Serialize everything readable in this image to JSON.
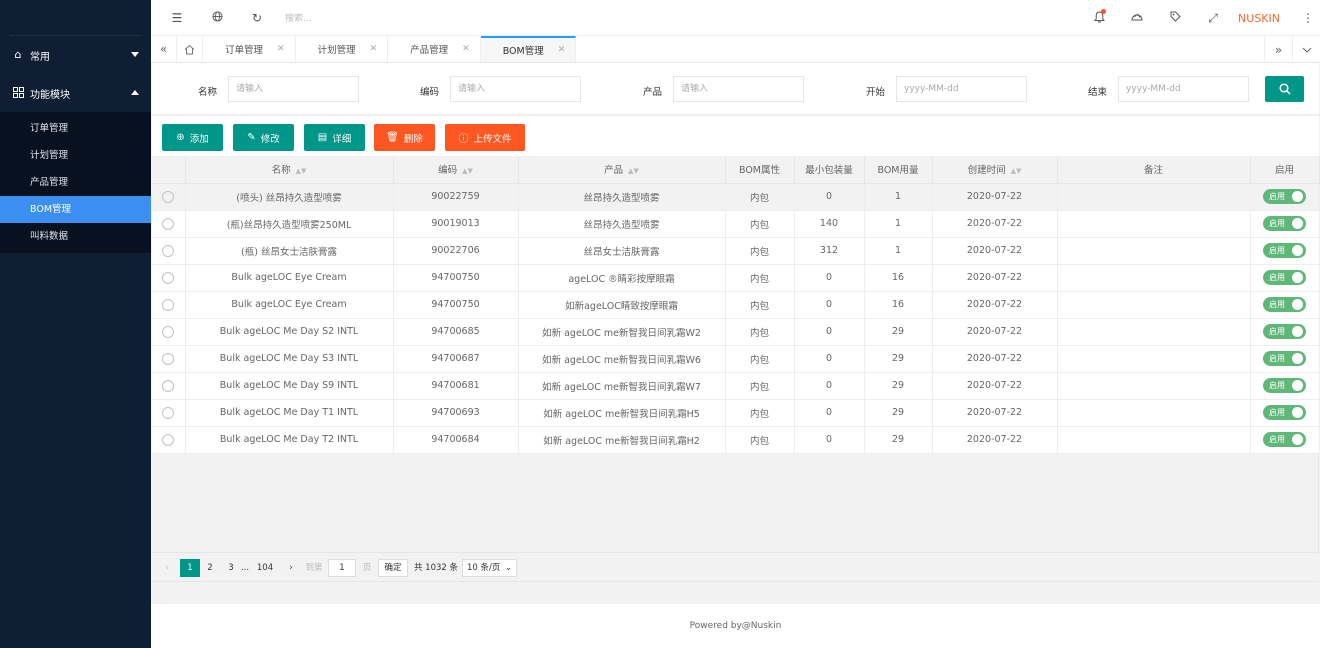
{
  "sidebar": {
    "groups": [
      {
        "label": "常用",
        "icon": "home-icon",
        "expanded": false
      },
      {
        "label": "功能模块",
        "icon": "grid-icon",
        "expanded": true
      }
    ],
    "items": [
      {
        "label": "订单管理",
        "active": false
      },
      {
        "label": "计划管理",
        "active": false
      },
      {
        "label": "产品管理",
        "active": false
      },
      {
        "label": "BOM管理",
        "active": true
      },
      {
        "label": "叫料数据",
        "active": false
      }
    ]
  },
  "topbar": {
    "search_placeholder": "搜索...",
    "brand": "NUSKIN"
  },
  "tabs": [
    {
      "label": "订单管理",
      "active": false
    },
    {
      "label": "计划管理",
      "active": false
    },
    {
      "label": "产品管理",
      "active": false
    },
    {
      "label": "BOM管理",
      "active": true
    }
  ],
  "filters": [
    {
      "label": "名称",
      "placeholder": "请输入"
    },
    {
      "label": "编码",
      "placeholder": "请输入"
    },
    {
      "label": "产品",
      "placeholder": "请输入"
    },
    {
      "label": "开始",
      "placeholder": "yyyy-MM-dd"
    },
    {
      "label": "结束",
      "placeholder": "yyyy-MM-dd"
    }
  ],
  "toolbar": {
    "add": "添加",
    "edit": "修改",
    "detail": "详细",
    "delete": "删除",
    "upload": "上传文件"
  },
  "table": {
    "headers": [
      "名称",
      "编码",
      "产品",
      "BOM属性",
      "最小包装量",
      "BOM用量",
      "创建时间",
      "备注",
      "启用"
    ],
    "rows": [
      {
        "name": "(喷头) 丝昂持久造型喷雾",
        "code": "90022759",
        "product": "丝昂持久造型喷雾",
        "attr": "内包",
        "min_pack": "0",
        "usage": "1",
        "created": "2020-07-22",
        "remark": "",
        "enabled": "启用"
      },
      {
        "name": "(瓶)丝昂持久造型喷雾250ML",
        "code": "90019013",
        "product": "丝昂持久造型喷雾",
        "attr": "内包",
        "min_pack": "140",
        "usage": "1",
        "created": "2020-07-22",
        "remark": "",
        "enabled": "启用"
      },
      {
        "name": "(瓶) 丝昂女士洁肤膏露",
        "code": "90022706",
        "product": "丝昂女士洁肤膏露",
        "attr": "内包",
        "min_pack": "312",
        "usage": "1",
        "created": "2020-07-22",
        "remark": "",
        "enabled": "启用"
      },
      {
        "name": "Bulk ageLOC Eye Cream",
        "code": "94700750",
        "product": "ageLOC ®睛彩按摩眼霜",
        "attr": "内包",
        "min_pack": "0",
        "usage": "16",
        "created": "2020-07-22",
        "remark": "",
        "enabled": "启用"
      },
      {
        "name": "Bulk ageLOC Eye Cream",
        "code": "94700750",
        "product": "如新ageLOC睛致按摩眼霜",
        "attr": "内包",
        "min_pack": "0",
        "usage": "16",
        "created": "2020-07-22",
        "remark": "",
        "enabled": "启用"
      },
      {
        "name": "Bulk ageLOC Me Day S2 INTL",
        "code": "94700685",
        "product": "如新 ageLOC me新智我日间乳霜W2",
        "attr": "内包",
        "min_pack": "0",
        "usage": "29",
        "created": "2020-07-22",
        "remark": "",
        "enabled": "启用"
      },
      {
        "name": "Bulk ageLOC Me Day S3 INTL",
        "code": "94700687",
        "product": "如新 ageLOC me新智我日间乳霜W6",
        "attr": "内包",
        "min_pack": "0",
        "usage": "29",
        "created": "2020-07-22",
        "remark": "",
        "enabled": "启用"
      },
      {
        "name": "Bulk ageLOC Me Day S9 INTL",
        "code": "94700681",
        "product": "如新 ageLOC me新智我日间乳霜W7",
        "attr": "内包",
        "min_pack": "0",
        "usage": "29",
        "created": "2020-07-22",
        "remark": "",
        "enabled": "启用"
      },
      {
        "name": "Bulk ageLOC Me Day T1 INTL",
        "code": "94700693",
        "product": "如新 ageLOC me新智我日间乳霜H5",
        "attr": "内包",
        "min_pack": "0",
        "usage": "29",
        "created": "2020-07-22",
        "remark": "",
        "enabled": "启用"
      },
      {
        "name": "Bulk ageLOC Me Day T2 INTL",
        "code": "94700684",
        "product": "如新 ageLOC me新智我日间乳霜H2",
        "attr": "内包",
        "min_pack": "0",
        "usage": "29",
        "created": "2020-07-22",
        "remark": "",
        "enabled": "启用"
      }
    ]
  },
  "pagination": {
    "pages": [
      "1",
      "2",
      "3",
      "...",
      "104"
    ],
    "current": "1",
    "goto_label": "到第",
    "goto_value": "1",
    "page_label": "页",
    "confirm": "确定",
    "total": "共 1032 条",
    "page_size": "10 条/页"
  },
  "footer": {
    "text": "Powered by@Nuskin"
  },
  "colors": {
    "sidebar_bg": "#0f1e33",
    "active": "#3b8ff0",
    "teal": "#009688",
    "orange": "#ff5722",
    "switch_on": "#5fb878",
    "brand": "#f1683a"
  }
}
